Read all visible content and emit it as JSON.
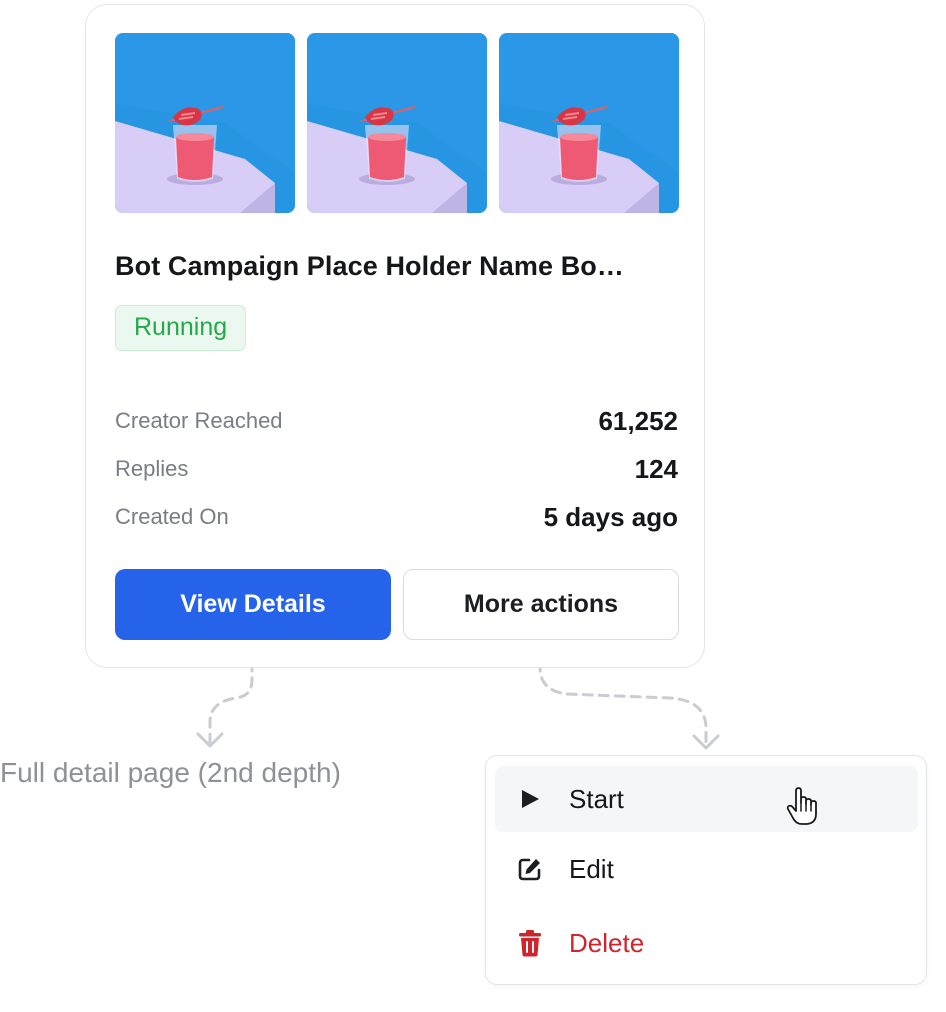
{
  "card": {
    "thumbnails": [
      {
        "alt": "drink-on-table-image"
      },
      {
        "alt": "drink-on-table-image"
      },
      {
        "alt": "drink-on-table-image"
      }
    ],
    "title": "Bot Campaign Place Holder Name Bo…",
    "status": "Running",
    "stats": [
      {
        "label": "Creator Reached",
        "value": "61,252"
      },
      {
        "label": "Replies",
        "value": "124"
      },
      {
        "label": "Created On",
        "value": "5 days ago"
      }
    ],
    "primary_button": "View Details",
    "secondary_button": "More actions"
  },
  "annotation": "Full detail page (2nd depth)",
  "menu": {
    "items": [
      {
        "label": "Start",
        "icon": "play-icon"
      },
      {
        "label": "Edit",
        "icon": "edit-icon"
      },
      {
        "label": "Delete",
        "icon": "trash-icon"
      }
    ]
  },
  "colors": {
    "primary": "#2563eb",
    "status_running": "#24a94a",
    "danger": "#d0242c",
    "thumb_bg": "#2a98e6"
  }
}
